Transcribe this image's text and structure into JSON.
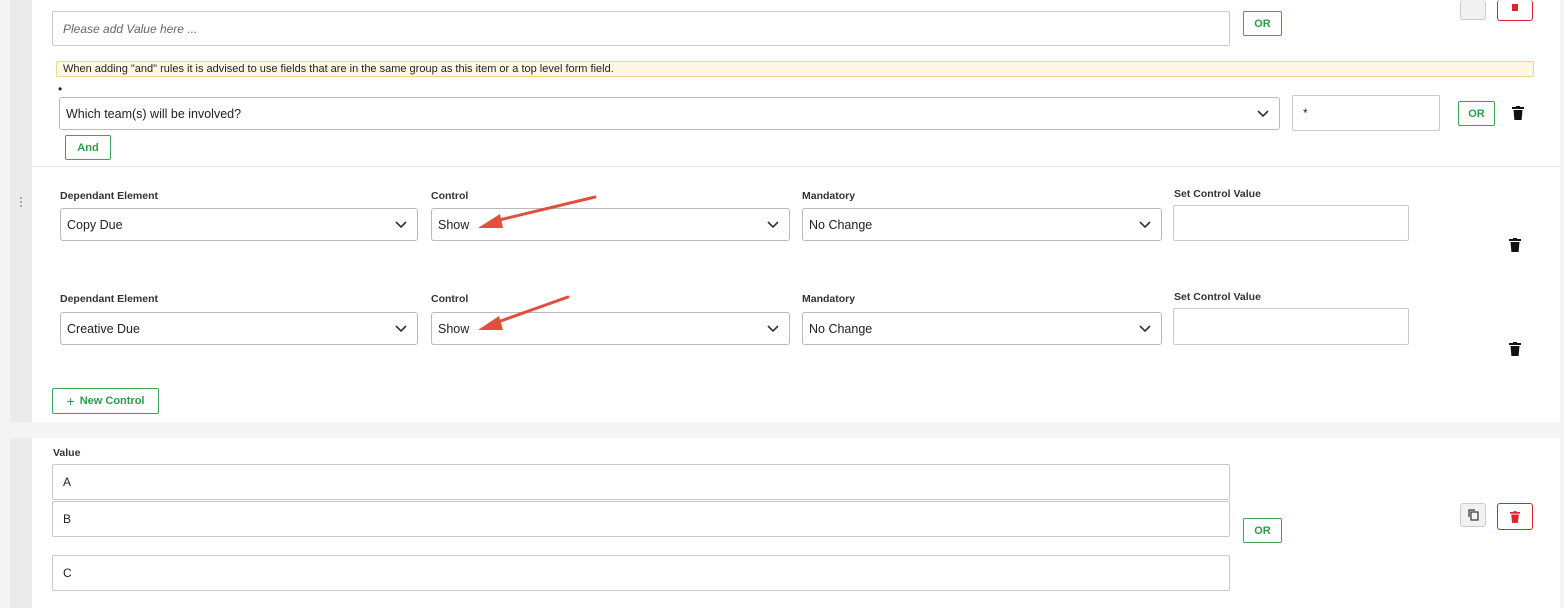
{
  "condition_block": {
    "value_placeholder": "Please add Value here ...",
    "or_label": "OR",
    "notice_text": "When adding \"and\" rules it is advised to use fields that are in the same group as this item or a top level form field.",
    "bullet": "•",
    "and_rule": {
      "field_selected": "Which team(s) will be involved?",
      "value": "*",
      "or_label": "OR"
    },
    "and_label": "And"
  },
  "controls": {
    "headers": {
      "dependant": "Dependant Element",
      "control": "Control",
      "mandatory": "Mandatory",
      "set_value": "Set Control Value"
    },
    "rows": [
      {
        "dependant": "Copy Due",
        "control": "Show",
        "mandatory": "No Change",
        "set_value": ""
      },
      {
        "dependant": "Creative Due",
        "control": "Show",
        "mandatory": "No Change",
        "set_value": ""
      }
    ],
    "new_control_label": "New Control",
    "new_control_icon": "plus-icon"
  },
  "values_block": {
    "label": "Value",
    "values": [
      "A",
      "B",
      "C"
    ],
    "or_label": "OR"
  },
  "colors": {
    "accent_green": "#2e9a4e",
    "danger_red": "#d9232e",
    "annotation_arrow": "#e0503a",
    "notice_bg": "#fff7e3"
  }
}
